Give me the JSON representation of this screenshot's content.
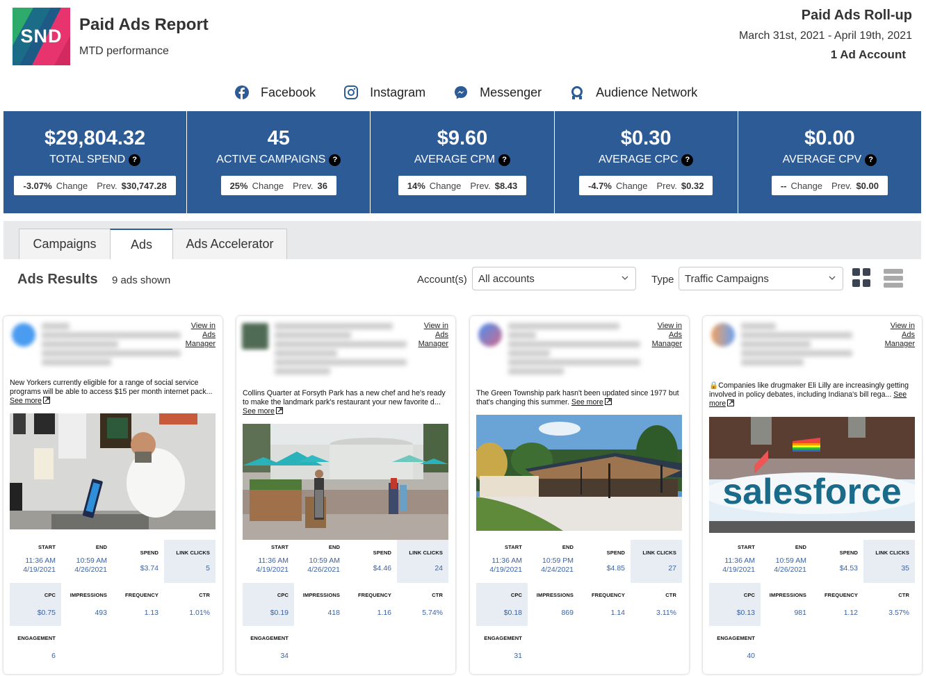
{
  "header": {
    "logo_text": "SND",
    "title": "Paid Ads Report",
    "subtitle": "MTD performance",
    "rollup_title": "Paid Ads Roll-up",
    "date_range": "March 31st, 2021 - April 19th, 2021",
    "accounts": "1 Ad Account"
  },
  "platforms": [
    {
      "label": "Facebook",
      "icon": "facebook-icon"
    },
    {
      "label": "Instagram",
      "icon": "instagram-icon"
    },
    {
      "label": "Messenger",
      "icon": "messenger-icon"
    },
    {
      "label": "Audience Network",
      "icon": "audience-network-icon"
    }
  ],
  "colors": {
    "brand_blue": "#2c5b96",
    "metric_blue": "#3a63a3",
    "highlight_cell": "#e8ecf3"
  },
  "kpis": [
    {
      "value": "$29,804.32",
      "label": "TOTAL SPEND",
      "change": "-3.07%",
      "change_label": "Change",
      "prev_label": "Prev.",
      "prev": "$30,747.28"
    },
    {
      "value": "45",
      "label": "ACTIVE CAMPAIGNS",
      "change": "25%",
      "change_label": "Change",
      "prev_label": "Prev.",
      "prev": "36"
    },
    {
      "value": "$9.60",
      "label": "AVERAGE CPM",
      "change": "14%",
      "change_label": "Change",
      "prev_label": "Prev.",
      "prev": "$8.43"
    },
    {
      "value": "$0.30",
      "label": "AVERAGE CPC",
      "change": "-4.7%",
      "change_label": "Change",
      "prev_label": "Prev.",
      "prev": "$0.32"
    },
    {
      "value": "$0.00",
      "label": "AVERAGE CPV",
      "change": "--",
      "change_label": "Change",
      "prev_label": "Prev.",
      "prev": "$0.00"
    }
  ],
  "help_glyph": "?",
  "tabs": [
    {
      "label": "Campaigns",
      "active": false
    },
    {
      "label": "Ads",
      "active": true
    },
    {
      "label": "Ads Accelerator",
      "active": false
    }
  ],
  "results": {
    "title": "Ads Results",
    "count": "9 ads shown",
    "account_label": "Account(s)",
    "account_value": "All accounts",
    "type_label": "Type",
    "type_value": "Traffic Campaigns"
  },
  "card_labels": {
    "view_line1": "View in",
    "view_line2": "Ads",
    "view_line3": "Manager",
    "see_more": "See more",
    "start": "START",
    "end": "END",
    "spend": "SPEND",
    "link_clicks": "LINK CLICKS",
    "cpc": "CPC",
    "impressions": "IMPRESSIONS",
    "frequency": "FREQUENCY",
    "ctr": "CTR",
    "engagement": "ENGAGEMENT"
  },
  "ads": [
    {
      "text": "New Yorkers currently eligible for a range of social service programs will be able to access $15 per month internet pack...",
      "start_time": "11:36 AM",
      "start_date": "4/19/2021",
      "end_time": "10:59 AM",
      "end_date": "4/26/2021",
      "spend": "$3.74",
      "link_clicks": "5",
      "cpc": "$0.75",
      "impressions": "493",
      "frequency": "1.13",
      "ctr": "1.01%",
      "engagement": "6"
    },
    {
      "text": "Collins Quarter at Forsyth Park has a new chef and he's ready to make the landmark park's restaurant your new favorite d...",
      "start_time": "11:36 AM",
      "start_date": "4/19/2021",
      "end_time": "10:59 AM",
      "end_date": "4/26/2021",
      "spend": "$4.46",
      "link_clicks": "24",
      "cpc": "$0.19",
      "impressions": "418",
      "frequency": "1.16",
      "ctr": "5.74%",
      "engagement": "34"
    },
    {
      "text": "The Green Township park hasn't been updated since 1977 but that's changing this summer.",
      "start_time": "11:36 AM",
      "start_date": "4/19/2021",
      "end_time": "10:59 PM",
      "end_date": "4/24/2021",
      "spend": "$4.85",
      "link_clicks": "27",
      "cpc": "$0.18",
      "impressions": "869",
      "frequency": "1.14",
      "ctr": "3.11%",
      "engagement": "31"
    },
    {
      "text": "🔒Companies like drugmaker Eli Lilly are increasingly getting involved in policy debates, including Indiana's bill rega...",
      "start_time": "11:36 AM",
      "start_date": "4/19/2021",
      "end_time": "10:59 AM",
      "end_date": "4/26/2021",
      "spend": "$4.53",
      "link_clicks": "35",
      "cpc": "$0.13",
      "impressions": "981",
      "frequency": "1.12",
      "ctr": "3.57%",
      "engagement": "40",
      "image_caption": "salesforce"
    }
  ]
}
